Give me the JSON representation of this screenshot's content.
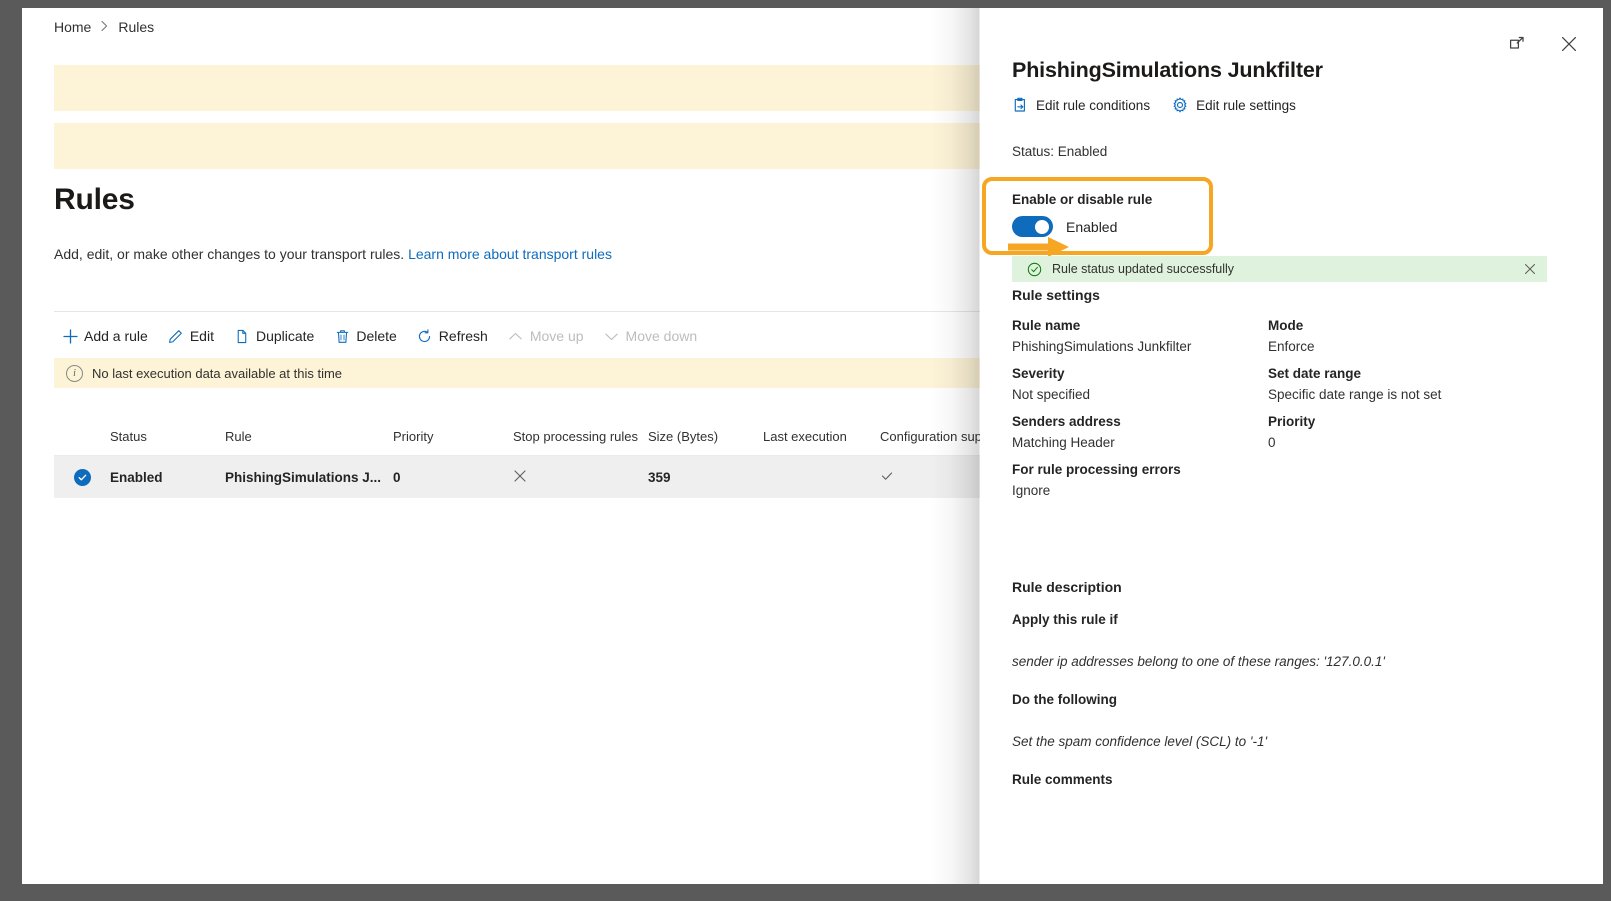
{
  "breadcrumb": {
    "home": "Home",
    "separator": ">",
    "current": "Rules"
  },
  "page": {
    "title": "Rules",
    "description": "Add, edit, or make other changes to your transport rules.",
    "learn_more_link": "Learn more about transport rules",
    "info_bar": "No last execution data available at this time"
  },
  "toolbar": {
    "add_rule": "Add a rule",
    "edit": "Edit",
    "duplicate": "Duplicate",
    "delete": "Delete",
    "refresh": "Refresh",
    "move_up": "Move up",
    "move_down": "Move down"
  },
  "table": {
    "columns": [
      "Status",
      "Rule",
      "Priority",
      "Stop processing rules",
      "Size (Bytes)",
      "Last execution",
      "Configuration supp"
    ],
    "rows": [
      {
        "selected": true,
        "status": "Enabled",
        "rule": "PhishingSimulations J...",
        "priority": "0",
        "stop_processing": "✕",
        "size": "359",
        "last_execution": "",
        "configuration_supported": "✓"
      }
    ]
  },
  "panel": {
    "title": "PhishingSimulations Junkfilter",
    "actions": {
      "edit_rule_conditions": "Edit rule conditions",
      "edit_rule_settings": "Edit rule settings"
    },
    "status_line": "Status: Enabled",
    "toggle": {
      "label": "Enable or disable rule",
      "state": "Enabled"
    },
    "success_message": "Rule status updated successfully",
    "rule_settings_heading": "Rule settings",
    "settings": [
      [
        {
          "key": "Rule name",
          "value": "PhishingSimulations Junkfilter"
        },
        {
          "key": "Mode",
          "value": "Enforce"
        }
      ],
      [
        {
          "key": "Severity",
          "value": "Not specified"
        },
        {
          "key": "Set date range",
          "value": "Specific date range is not set"
        }
      ],
      [
        {
          "key": "Senders address",
          "value": "Matching Header"
        },
        {
          "key": "Priority",
          "value": "0"
        }
      ],
      [
        {
          "key": "For rule processing errors",
          "value": "Ignore"
        }
      ]
    ],
    "rule_description_heading": "Rule description",
    "description": {
      "apply_title": "Apply this rule if",
      "apply_value": "sender ip addresses belong to one of these ranges: '127.0.0.1'",
      "do_title": "Do the following",
      "do_value": "Set the spam confidence level (SCL) to '-1'",
      "comments_title": "Rule comments"
    }
  },
  "colors": {
    "accent": "#0f6cbd",
    "annotation": "#f5a623",
    "success_bg": "#dff2dd",
    "warning_bg": "#fdf3d7"
  }
}
